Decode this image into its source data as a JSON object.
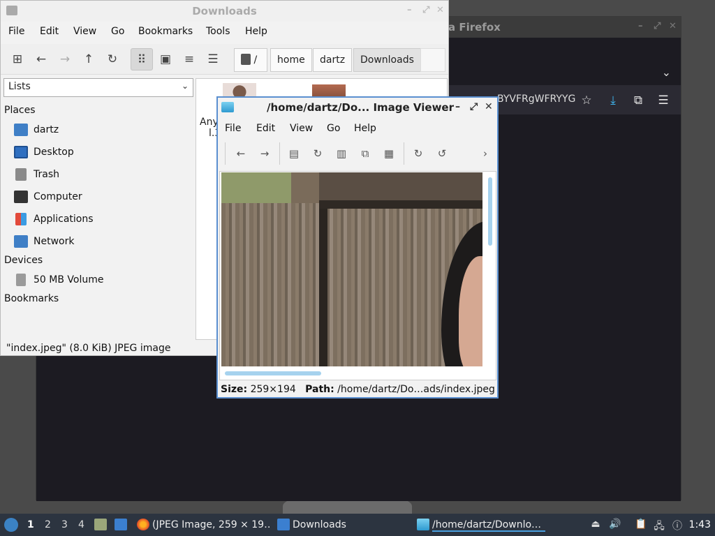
{
  "firefox": {
    "title": "a Firefox",
    "url_fragment": "BYVFRgWFRYYG",
    "tab_chevron": "⌄",
    "icons": [
      "star-icon",
      "download-icon",
      "extensions-icon",
      "menu-icon"
    ]
  },
  "file_manager": {
    "title": "Downloads",
    "menu": [
      "File",
      "Edit",
      "View",
      "Go",
      "Bookmarks",
      "Tools",
      "Help"
    ],
    "breadcrumbs": [
      "/",
      "home",
      "dartz",
      "Downloads"
    ],
    "side_select": "Lists",
    "places_header": "Places",
    "places": [
      "dartz",
      "Desktop",
      "Trash",
      "Computer",
      "Applications",
      "Network"
    ],
    "devices_header": "Devices",
    "devices": [
      "50 MB Volume"
    ],
    "bookmarks_header": "Bookmarks",
    "view_text": [
      "Any",
      "l.3"
    ],
    "status": "\"index.jpeg\" (8.0 KiB) JPEG image"
  },
  "image_viewer": {
    "title": "/home/dartz/Do... Image Viewer",
    "menu": [
      "File",
      "Edit",
      "View",
      "Go",
      "Help"
    ],
    "size_label": "Size:",
    "size_value": "259×194",
    "path_label": "Path:",
    "path_value": "/home/dartz/Do…ads/index.jpeg"
  },
  "taskbar": {
    "workspaces": [
      "1",
      "2",
      "3",
      "4"
    ],
    "tasks": [
      "(JPEG Image, 259 × 19…",
      "Downloads",
      "/home/dartz/Downlo…"
    ],
    "clock": "1:43"
  },
  "colors": {
    "accent": "#5a8fd0",
    "taskbar": "#2c3440",
    "firefox_bg": "#1c1b22"
  }
}
